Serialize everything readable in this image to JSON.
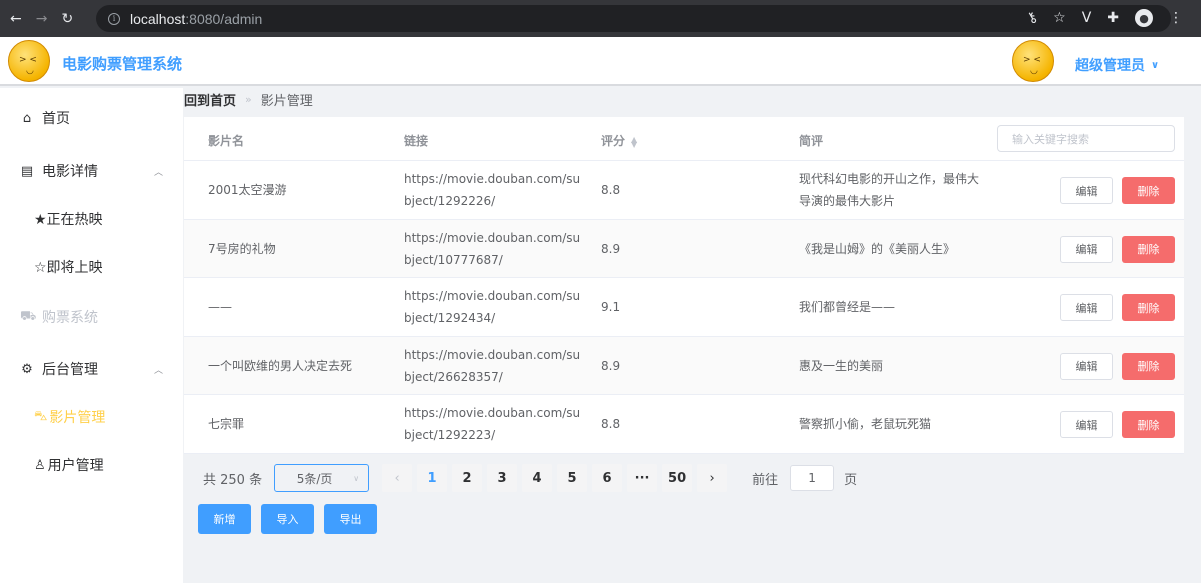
{
  "browser": {
    "url_host": "localhost",
    "url_path": ":8080/admin"
  },
  "header": {
    "app_title": "电影购票管理系统",
    "user_name": "超级管理员"
  },
  "sidebar": {
    "items": [
      {
        "label": "首页",
        "icon": "home-icon"
      },
      {
        "label": "电影详情",
        "icon": "document-icon",
        "expanded": true
      },
      {
        "label": "★正在热映"
      },
      {
        "label": "☆即将上映"
      },
      {
        "label": "购票系统",
        "icon": "cart-icon",
        "disabled": true
      },
      {
        "label": "后台管理",
        "icon": "gear-icon",
        "expanded": true
      },
      {
        "label": "影片管理",
        "icon": "car-icon",
        "active": true
      },
      {
        "label": "用户管理",
        "icon": "user-icon"
      }
    ]
  },
  "breadcrumb": {
    "home": "回到首页",
    "separator": "»",
    "current": "影片管理"
  },
  "table": {
    "headers": {
      "name": "影片名",
      "link": "链接",
      "score": "评分",
      "review": "简评"
    },
    "search_placeholder": "输入关键字搜索",
    "edit_label": "编辑",
    "delete_label": "删除",
    "rows": [
      {
        "name": "2001太空漫游",
        "link": "https://movie.douban.com/subject/1292226/",
        "score": "8.8",
        "review": "现代科幻电影的开山之作，最伟大导演的最伟大影片"
      },
      {
        "name": "7号房的礼物",
        "link": "https://movie.douban.com/subject/10777687/",
        "score": "8.9",
        "review": "《我是山姆》的《美丽人生》"
      },
      {
        "name": "——",
        "link": "https://movie.douban.com/subject/1292434/",
        "score": "9.1",
        "review": "我们都曾经是——"
      },
      {
        "name": "一个叫欧维的男人决定去死",
        "link": "https://movie.douban.com/subject/26628357/",
        "score": "8.9",
        "review": "惠及一生的美丽"
      },
      {
        "name": "七宗罪",
        "link": "https://movie.douban.com/subject/1292223/",
        "score": "8.8",
        "review": "警察抓小偷，老鼠玩死猫"
      }
    ]
  },
  "pagination": {
    "total": "共 250 条",
    "page_size": "5条/页",
    "pages": [
      "1",
      "2",
      "3",
      "4",
      "5",
      "6",
      "···",
      "50"
    ],
    "current_page": "1",
    "goto_label": "前往",
    "goto_value": "1",
    "page_unit": "页"
  },
  "actions": {
    "add": "新增",
    "import": "导入",
    "export": "导出"
  },
  "colors": {
    "primary": "#409eff",
    "danger": "#f56c6c",
    "active_menu": "#ffd04b"
  }
}
